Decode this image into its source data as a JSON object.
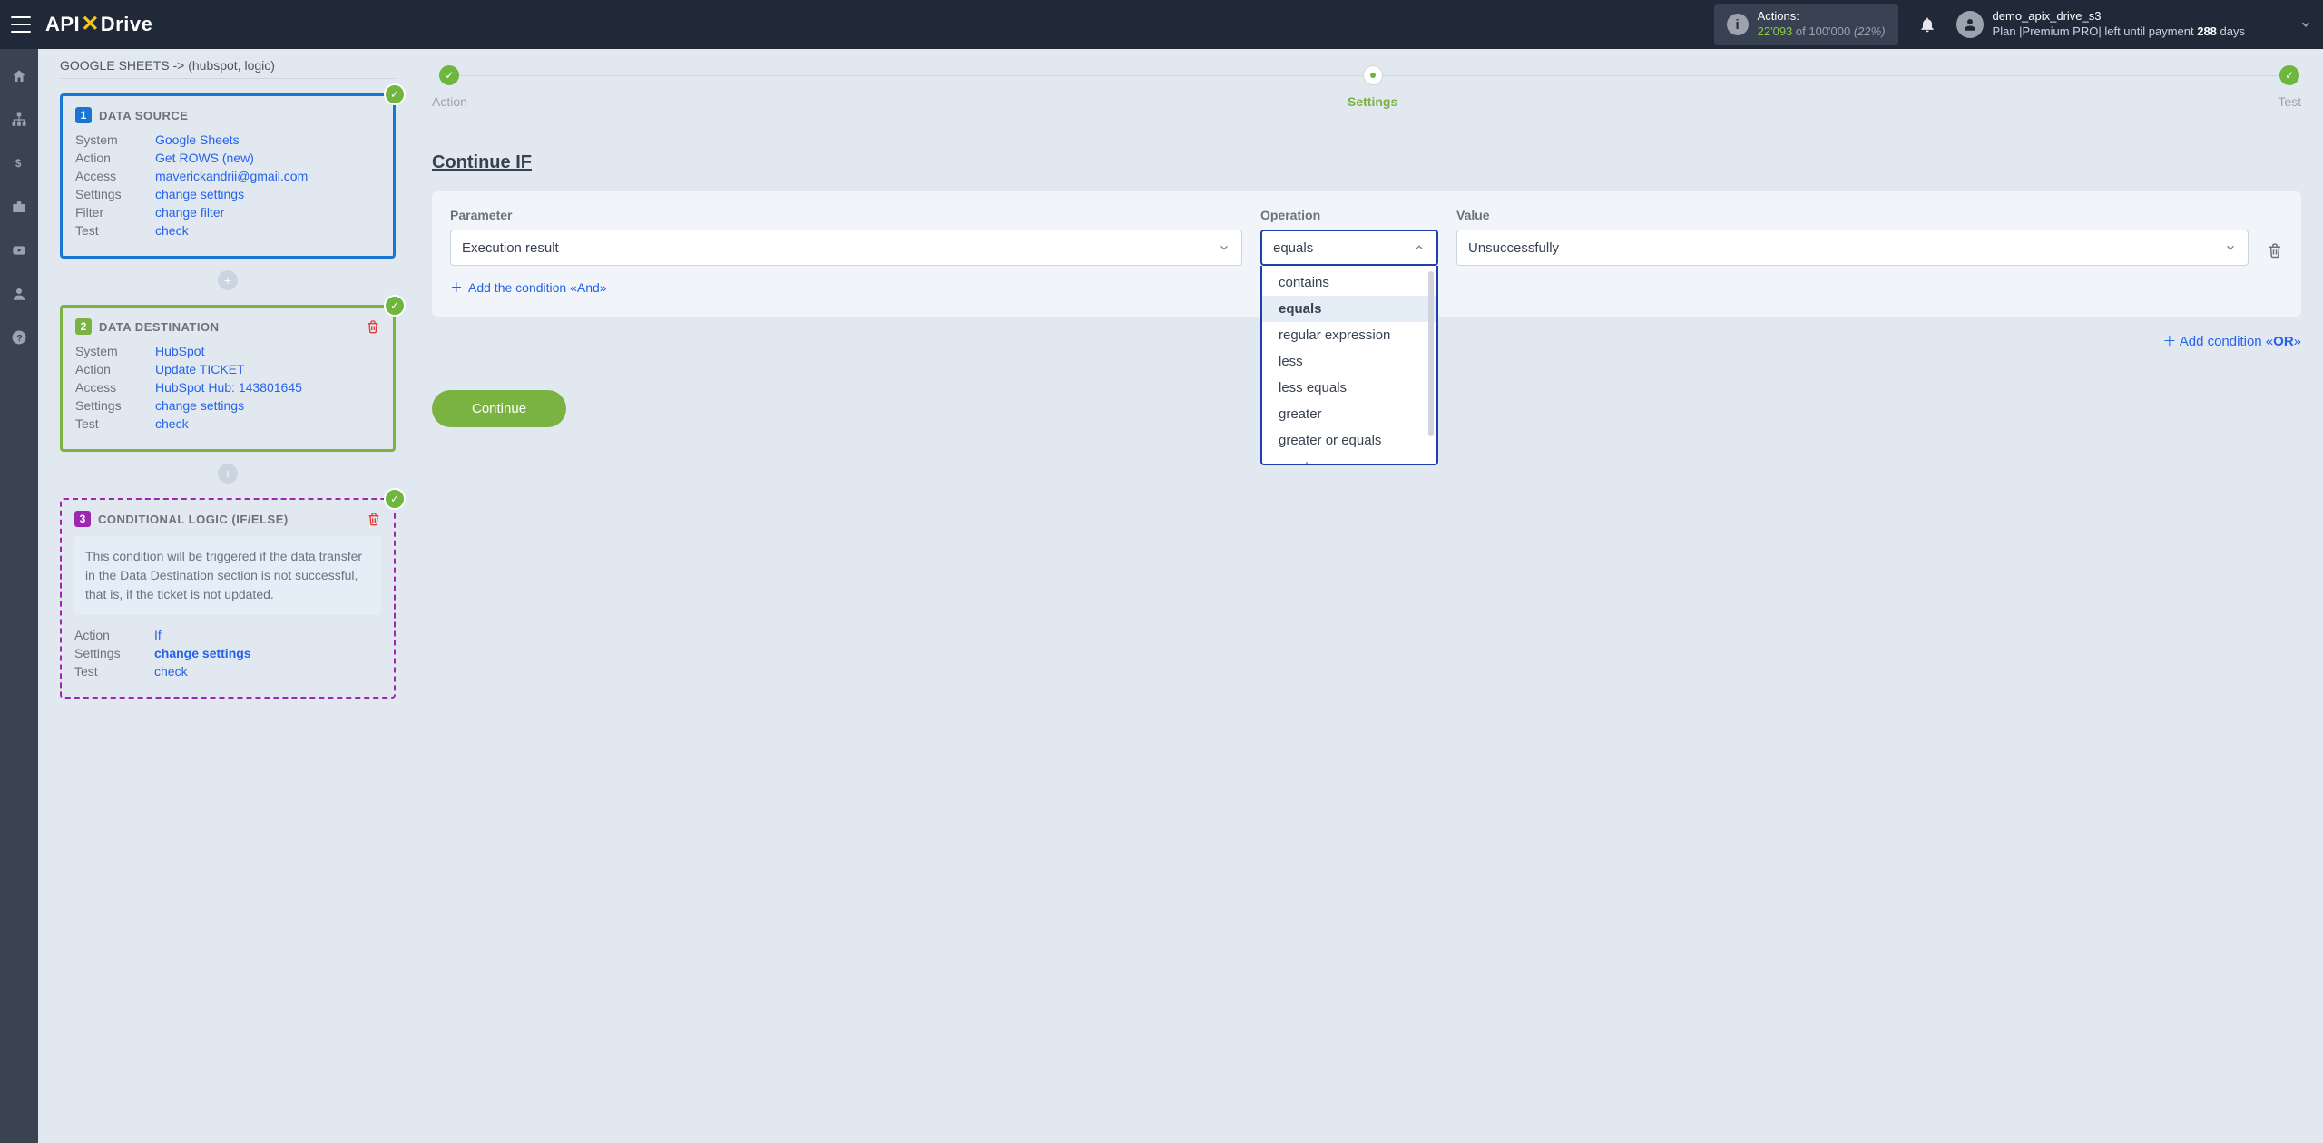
{
  "topbar": {
    "actions_label": "Actions:",
    "actions_used": "22'093",
    "actions_of": " of ",
    "actions_max": "100'000 ",
    "actions_pct": "(22%)",
    "username": "demo_apix_drive_s3",
    "plan_prefix": "Plan |",
    "plan_name": "Premium PRO",
    "plan_suffix": "| left until payment ",
    "days": "288",
    "days_unit": " days"
  },
  "breadcrumb": "GOOGLE SHEETS -> (hubspot, logic)",
  "source": {
    "title": "DATA SOURCE",
    "system_k": "System",
    "system_v": "Google Sheets",
    "action_k": "Action",
    "action_v": "Get ROWS (new)",
    "access_k": "Access",
    "access_v": "maverickandrii@gmail.com",
    "settings_k": "Settings",
    "settings_v": "change settings",
    "filter_k": "Filter",
    "filter_v": "change filter",
    "test_k": "Test",
    "test_v": "check"
  },
  "dest": {
    "title": "DATA DESTINATION",
    "system_k": "System",
    "system_v": "HubSpot",
    "action_k": "Action",
    "action_v": "Update TICKET",
    "access_k": "Access",
    "access_v": "HubSpot Hub: 143801645",
    "settings_k": "Settings",
    "settings_v": "change settings",
    "test_k": "Test",
    "test_v": "check"
  },
  "logic": {
    "title": "CONDITIONAL LOGIC (IF/ELSE)",
    "desc": "This condition will be triggered if the data transfer in the Data Destination section is not successful, that is, if the ticket is not updated.",
    "action_k": "Action",
    "action_v": "If",
    "settings_k": "Settings",
    "settings_v": "change settings",
    "test_k": "Test",
    "test_v": "check"
  },
  "steps": {
    "action": "Action",
    "settings": "Settings",
    "test": "Test"
  },
  "section_title": "Continue IF",
  "labels": {
    "parameter": "Parameter",
    "operation": "Operation",
    "value": "Value"
  },
  "values": {
    "parameter": "Execution result",
    "operation": "equals",
    "value": "Unsuccessfully"
  },
  "dropdown_options": [
    "contains",
    "equals",
    "regular expression",
    "less",
    "less equals",
    "greater",
    "greater or equals",
    "empty"
  ],
  "add_and": "Add the condition «And»",
  "add_or_prefix": "Add condition «",
  "add_or_bold": "OR",
  "add_or_suffix": "»",
  "continue": "Continue"
}
